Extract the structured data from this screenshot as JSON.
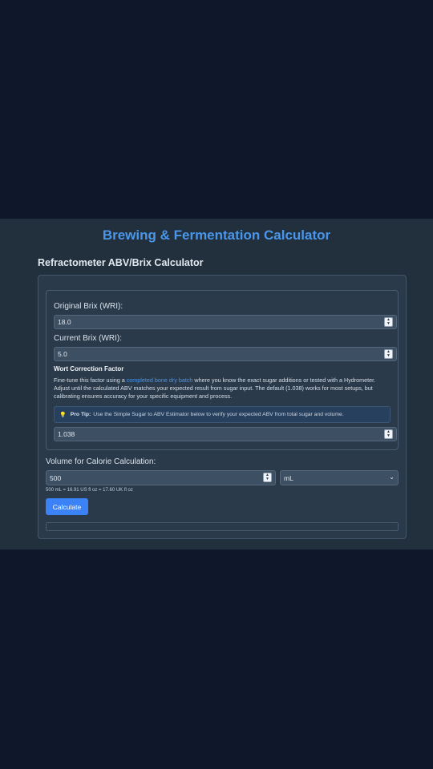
{
  "header": {
    "title": "Brewing & Fermentation Calculator"
  },
  "section": {
    "title": "Refractometer ABV/Brix Calculator"
  },
  "form": {
    "original_brix_label": "Original Brix (WRI):",
    "original_brix_value": "18.0",
    "current_brix_label": "Current Brix (WRI):",
    "current_brix_value": "5.0",
    "wcf_title": "Wort Correction Factor",
    "wcf_desc_pre": "Fine-tune this factor using a ",
    "wcf_desc_link": "completed bone dry batch",
    "wcf_desc_post": " where you know the exact sugar additions or tested with a Hydrometer. Adjust until the calculated ABV matches your expected result from sugar input. The default (1.038) works for most setups, but calibrating ensures accuracy for your specific equipment and process.",
    "tip_icon": "lightbulb-icon",
    "tip_bold": "Pro Tip:",
    "tip_text": "Use the Simple Sugar to ABV Estimator below to verify your expected ABV from total sugar and volume.",
    "wcf_value": "1.038",
    "volume_label": "Volume for Calorie Calculation:",
    "volume_value": "500",
    "unit_selected": "mL",
    "conversion_text": "500 mL = 16.91 US fl oz = 17.60 UK fl oz",
    "calculate_label": "Calculate"
  },
  "colors": {
    "accent": "#3b82f6",
    "title": "#4a97ea",
    "background": "#0f172a",
    "panel": "#2b3a4a"
  }
}
